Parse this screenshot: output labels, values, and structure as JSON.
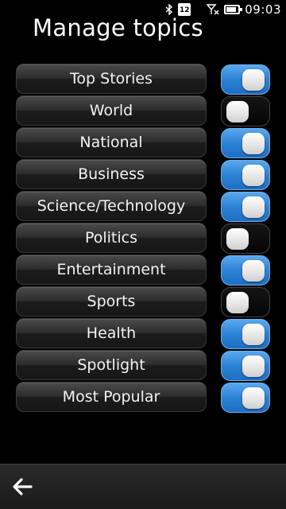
{
  "status_bar": {
    "bluetooth_icon": "bluetooth-icon",
    "calendar_day": "12",
    "signal_icon": "no-signal-icon",
    "battery_level": 0.85,
    "time": "09:03"
  },
  "title": "Manage topics",
  "topics": [
    {
      "label": "Top Stories",
      "enabled": true
    },
    {
      "label": "World",
      "enabled": false
    },
    {
      "label": "National",
      "enabled": true
    },
    {
      "label": "Business",
      "enabled": true
    },
    {
      "label": "Science/Technology",
      "enabled": true
    },
    {
      "label": "Politics",
      "enabled": false
    },
    {
      "label": "Entertainment",
      "enabled": true
    },
    {
      "label": "Sports",
      "enabled": false
    },
    {
      "label": "Health",
      "enabled": true
    },
    {
      "label": "Spotlight",
      "enabled": true
    },
    {
      "label": "Most Popular",
      "enabled": true
    }
  ],
  "toolbar": {
    "back_icon": "back-arrow-icon"
  },
  "colors": {
    "toggle_on": "#2d82d6",
    "toggle_off": "#0a0a0a",
    "background": "#000000"
  }
}
